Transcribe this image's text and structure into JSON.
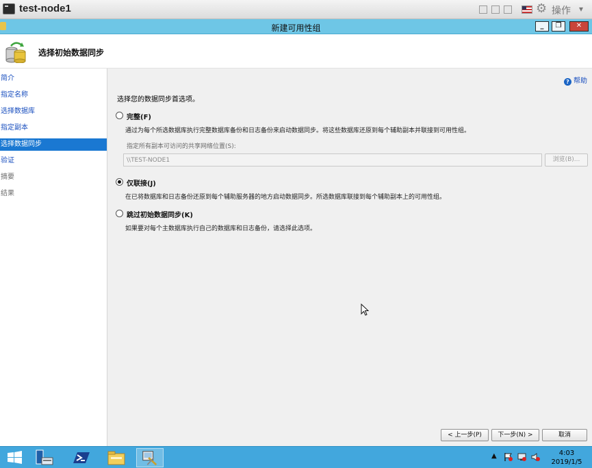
{
  "vm_bar": {
    "title": "test-node1",
    "action_label": "操作"
  },
  "window": {
    "title": "新建可用性组"
  },
  "header": {
    "title": "选择初始数据同步"
  },
  "nav": {
    "items": [
      {
        "label": "简介"
      },
      {
        "label": "指定名称"
      },
      {
        "label": "选择数据库"
      },
      {
        "label": "指定副本"
      },
      {
        "label": "选择数据同步"
      },
      {
        "label": "验证"
      },
      {
        "label": "摘要"
      },
      {
        "label": "结果"
      }
    ]
  },
  "main": {
    "help_label": "帮助",
    "instruction": "选择您的数据同步首选项。",
    "options": [
      {
        "label": "完整(F)",
        "description": "通过为每个所选数据库执行完整数据库备份和日志备份来启动数据同步。将这些数据库还原到每个辅助副本并联接到可用性组。",
        "checked": false
      },
      {
        "label": "仅联接(J)",
        "description": "在已将数据库和日志备份还原到每个辅助服务器的地方启动数据同步。所选数据库联接到每个辅助副本上的可用性组。",
        "checked": true
      },
      {
        "label": "跳过初始数据同步(K)",
        "description": "如果要对每个主数据库执行自己的数据库和日志备份，请选择此选项。",
        "checked": false
      }
    ],
    "share_label": "指定所有副本可访问的共享网络位置(S):",
    "share_value": "\\\\TEST-NODE1",
    "browse_label": "浏览(B)..."
  },
  "footer": {
    "prev_label": "< 上一步(P)",
    "next_label": "下一步(N) >",
    "cancel_label": "取消"
  },
  "taskbar": {
    "time": "4:03",
    "date": "2019/1/5"
  },
  "colors": {
    "title_bar": "#6ec6e6",
    "nav_active": "#1a78d2",
    "taskbar": "#42a7dd"
  }
}
